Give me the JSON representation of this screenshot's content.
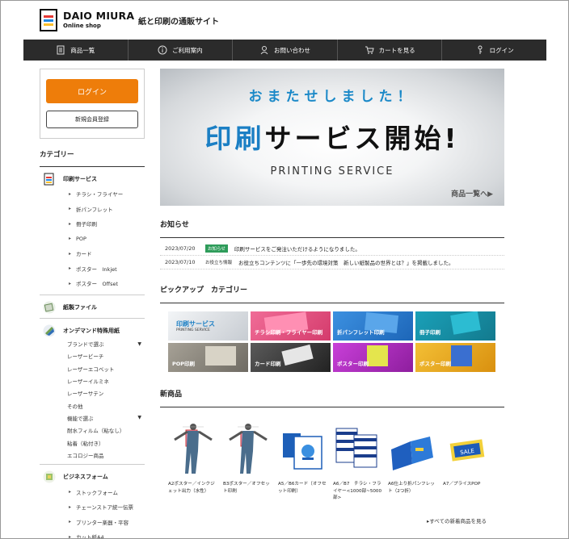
{
  "header": {
    "logo_title": "DAIO MIURA",
    "logo_sub": "Online shop",
    "tagline": "紙と印刷の通販サイト"
  },
  "nav": [
    {
      "label": "商品一覧",
      "icon": "document-list-icon"
    },
    {
      "label": "ご利用案内",
      "icon": "info-icon"
    },
    {
      "label": "お問い合わせ",
      "icon": "person-headset-icon"
    },
    {
      "label": "カートを見る",
      "icon": "cart-icon"
    },
    {
      "label": "ログイン",
      "icon": "key-icon"
    }
  ],
  "sidebar": {
    "login_label": "ログイン",
    "register_label": "新規会員登録",
    "category_title": "カテゴリー",
    "groups": [
      {
        "label": "印刷サービス",
        "icon": "print-document-icon",
        "items": [
          "チラシ・フライヤー",
          "折パンフレット",
          "冊子印刷",
          "POP",
          "カード",
          "ポスター　Inkjet",
          "ポスター　Offset"
        ]
      },
      {
        "label": "紙製ファイル",
        "icon": "paper-file-icon",
        "items": []
      },
      {
        "label": "オンデマンド特殊用紙",
        "icon": "paper-roll-icon",
        "plain_items": [
          {
            "label": "ブランドで選ぶ",
            "expand": true
          },
          {
            "label": "レーザービーチ"
          },
          {
            "label": "レーザーエコベット"
          },
          {
            "label": "レーザーイルミネ"
          },
          {
            "label": "レーザーサテン"
          },
          {
            "label": "その他"
          },
          {
            "label": "機能で選ぶ",
            "expand": true
          },
          {
            "label": "耐水フィルム（粘なし）"
          },
          {
            "label": "粘着（粘付き）"
          },
          {
            "label": "エコロジー商品"
          }
        ]
      },
      {
        "label": "ビジネスフォーム",
        "icon": "business-form-icon",
        "items": [
          "ストックフォーム",
          "チェーンストア統一伝票",
          "プリンター楽器・平容",
          "カット紙A4"
        ]
      }
    ]
  },
  "banner": {
    "sub": "おまたせしました！",
    "main_blue": "印刷",
    "main_black": "サービス開始!",
    "english": "PRINTING SERVICE",
    "link": "商品一覧へ▶"
  },
  "news": {
    "title": "お知らせ",
    "rows": [
      {
        "date": "2023/07/20",
        "badge": "お知らせ",
        "badge_style": "green",
        "text": "印刷サービスをご発注いただけるようになりました。"
      },
      {
        "date": "2023/07/10",
        "badge": "お役立ち情報",
        "badge_style": "plain",
        "text": "お役立ちコンテンツに「一歩先の環境対策　新しい紙製品の世界とは？」を掲載しました。"
      }
    ]
  },
  "pickup": {
    "title": "ピックアップ　カテゴリー",
    "tiles": [
      {
        "label": "印刷サービス",
        "sub": "PRINTING SERVICE",
        "color": "#d9dde2"
      },
      {
        "label": "チラシ印刷・フライヤー印刷",
        "color": "#e0457a"
      },
      {
        "label": "折パンフレット印刷",
        "color": "#2a7fd0"
      },
      {
        "label": "冊子印刷",
        "color": "#1790a8"
      },
      {
        "label": "POP印刷",
        "color": "#8f8a80"
      },
      {
        "label": "カード印刷",
        "color": "#3c3c3c"
      },
      {
        "label": "ポスター印刷",
        "color": "#b22fc0"
      },
      {
        "label": "ポスター印刷",
        "color": "#e8a81e"
      }
    ]
  },
  "newitems": {
    "title": "新商品",
    "products": [
      {
        "name": "A2ポスター／インクジェット出力（水性）"
      },
      {
        "name": "B3ポスター／オフセット印刷"
      },
      {
        "name": "A5／B6カード（オフセット印刷）"
      },
      {
        "name": "A6／B7　チラシ・フライヤー<1000部~5000部>"
      },
      {
        "name": "A6仕上り折パンフレット（2つ折）"
      },
      {
        "name": "A7／プライスPOP"
      }
    ],
    "more_link": "▸すべての新着商品を見る",
    "sale_text": "SALE"
  },
  "colors": {
    "accent_orange": "#ee7d0a",
    "nav_bg": "#2b2b2b",
    "brand_blue": "#1b7fc4",
    "badge_green": "#2e9c5a"
  }
}
